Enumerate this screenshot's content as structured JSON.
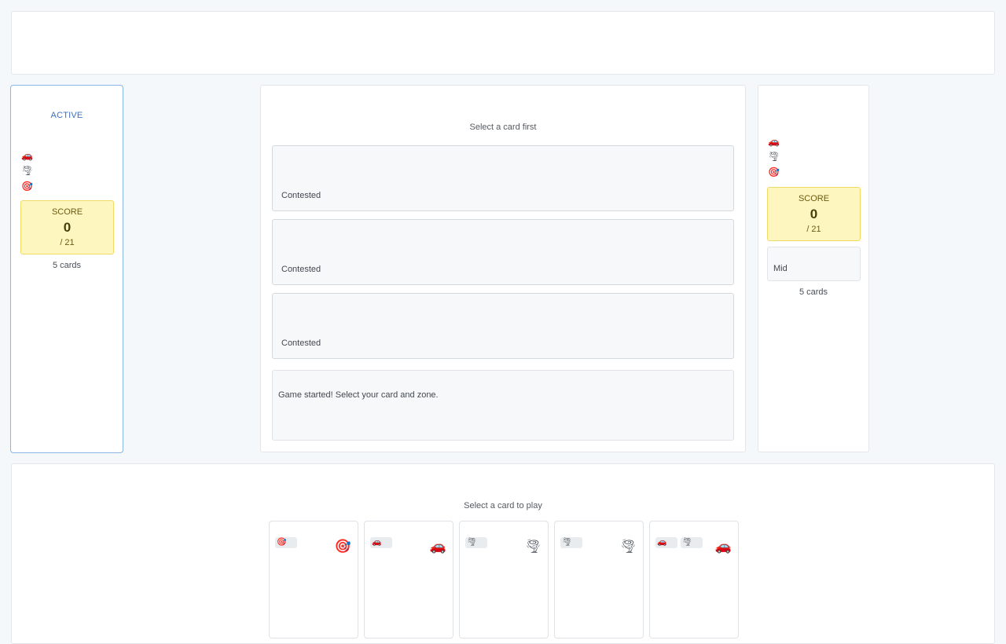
{
  "player": {
    "status": "ACTIVE",
    "resources": [
      {
        "icon": "🚗",
        "icon_name": "car-icon"
      },
      {
        "icon": "🌪",
        "icon_name": "tornado-icon"
      },
      {
        "icon": "🎯",
        "icon_name": "target-icon"
      }
    ],
    "score_label": "SCORE",
    "score": "0",
    "score_max": "/ 21",
    "cards_count": "5 cards"
  },
  "board": {
    "hint": "Select a card first",
    "zones": [
      {
        "status": "Contested"
      },
      {
        "status": "Contested"
      },
      {
        "status": "Contested"
      }
    ],
    "log": {
      "line": "Game started! Select your card and zone."
    }
  },
  "opponent": {
    "resources": [
      {
        "icon": "🚗",
        "icon_name": "car-icon"
      },
      {
        "icon": "🌪",
        "icon_name": "tornado-icon"
      },
      {
        "icon": "🎯",
        "icon_name": "target-icon"
      }
    ],
    "score_label": "SCORE",
    "score": "0",
    "score_max": "/ 21",
    "strategy_value": "Mid",
    "cards_count": "5 cards"
  },
  "hand": {
    "hint": "Select a card to play",
    "cards": [
      {
        "chips": [
          {
            "icon": "🎯"
          }
        ],
        "big_icon": "🎯",
        "big_icon_name": "target-icon"
      },
      {
        "chips": [
          {
            "icon": "🚗"
          }
        ],
        "big_icon": "🚗",
        "big_icon_name": "car-icon"
      },
      {
        "chips": [
          {
            "icon": "🌪"
          }
        ],
        "big_icon": "🌪",
        "big_icon_name": "tornado-icon"
      },
      {
        "chips": [
          {
            "icon": "🌪"
          }
        ],
        "big_icon": "🌪",
        "big_icon_name": "tornado-icon"
      },
      {
        "chips": [
          {
            "icon": "🚗"
          },
          {
            "icon": "🌪"
          }
        ],
        "big_icon": "🚗",
        "big_icon_name": "car-icon"
      }
    ]
  },
  "colors": {
    "accent": "#3a6fc0",
    "score_bg": "#fdf6bf",
    "score_border": "#f0da66"
  }
}
